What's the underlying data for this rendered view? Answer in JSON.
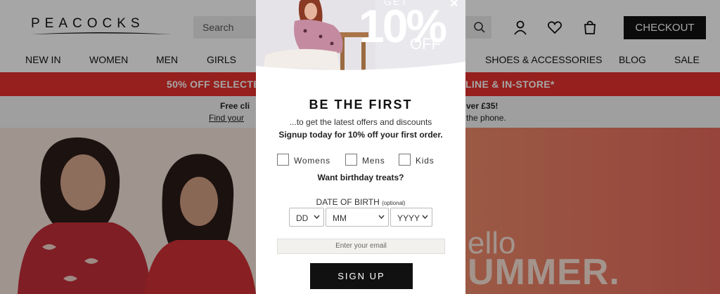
{
  "header": {
    "logo": "PEACOCKS",
    "search_placeholder": "Search",
    "checkout_label": "CHECKOUT",
    "icons": [
      "account-icon",
      "heart-icon",
      "bag-icon",
      "search-icon"
    ]
  },
  "nav": {
    "items": [
      "NEW IN",
      "WOMEN",
      "MEN",
      "GIRLS",
      "SHOES & ACCESSORIES",
      "BLOG",
      "SALE"
    ]
  },
  "promo": {
    "left": "50% OFF SELECTE",
    "right": "LINE & IN-STORE*"
  },
  "info": {
    "line1_left": "Free cli",
    "line1_right": "ver £35!",
    "line2_left": "Find your",
    "line2_right": "the phone."
  },
  "hero": {
    "hello": "ello",
    "summer": "UMMER."
  },
  "modal": {
    "get": "GET",
    "percent": "10%",
    "off": "OFF",
    "title": "BE THE FIRST",
    "subtitle": "...to get the latest offers and discounts",
    "subtitle2": "Signup today for 10% off your first order.",
    "checkboxes": [
      "Womens",
      "Mens",
      "Kids"
    ],
    "birthday": "Want birthday treats?",
    "dob_label": "DATE OF BIRTH",
    "dob_optional": "(optional)",
    "selects": [
      "DD",
      "MM",
      "YYYY"
    ],
    "email_placeholder": "Enter your email",
    "signup_label": "SIGN UP",
    "close": "×"
  },
  "colors": {
    "promo_red": "#e5322d",
    "checkout_bg": "#111111",
    "hero_accent": "#ee8a6a"
  }
}
